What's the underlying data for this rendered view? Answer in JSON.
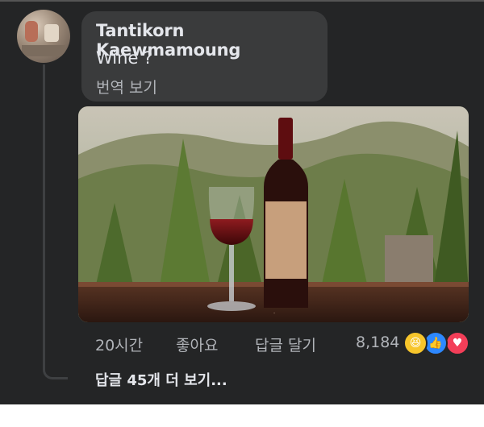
{
  "comment": {
    "author": "Tantikorn Kaewmamoung",
    "text": "Wine ?",
    "translate_label": "번역 보기"
  },
  "actions": {
    "time": "20시간",
    "like_label": "좋아요",
    "reply_label": "답글 달기"
  },
  "reactions": {
    "count": "8,184",
    "icons": [
      "haha-icon",
      "like-icon",
      "love-icon"
    ]
  },
  "more_replies_label": "답글 45개 더 보기...",
  "colors": {
    "background": "#242526",
    "bubble": "#3a3b3c",
    "text_primary": "#e4e6eb",
    "text_secondary": "#b0b3b8",
    "like_blue": "#2d88ff",
    "love_red": "#f33e58",
    "haha_yellow": "#f7c52b"
  }
}
